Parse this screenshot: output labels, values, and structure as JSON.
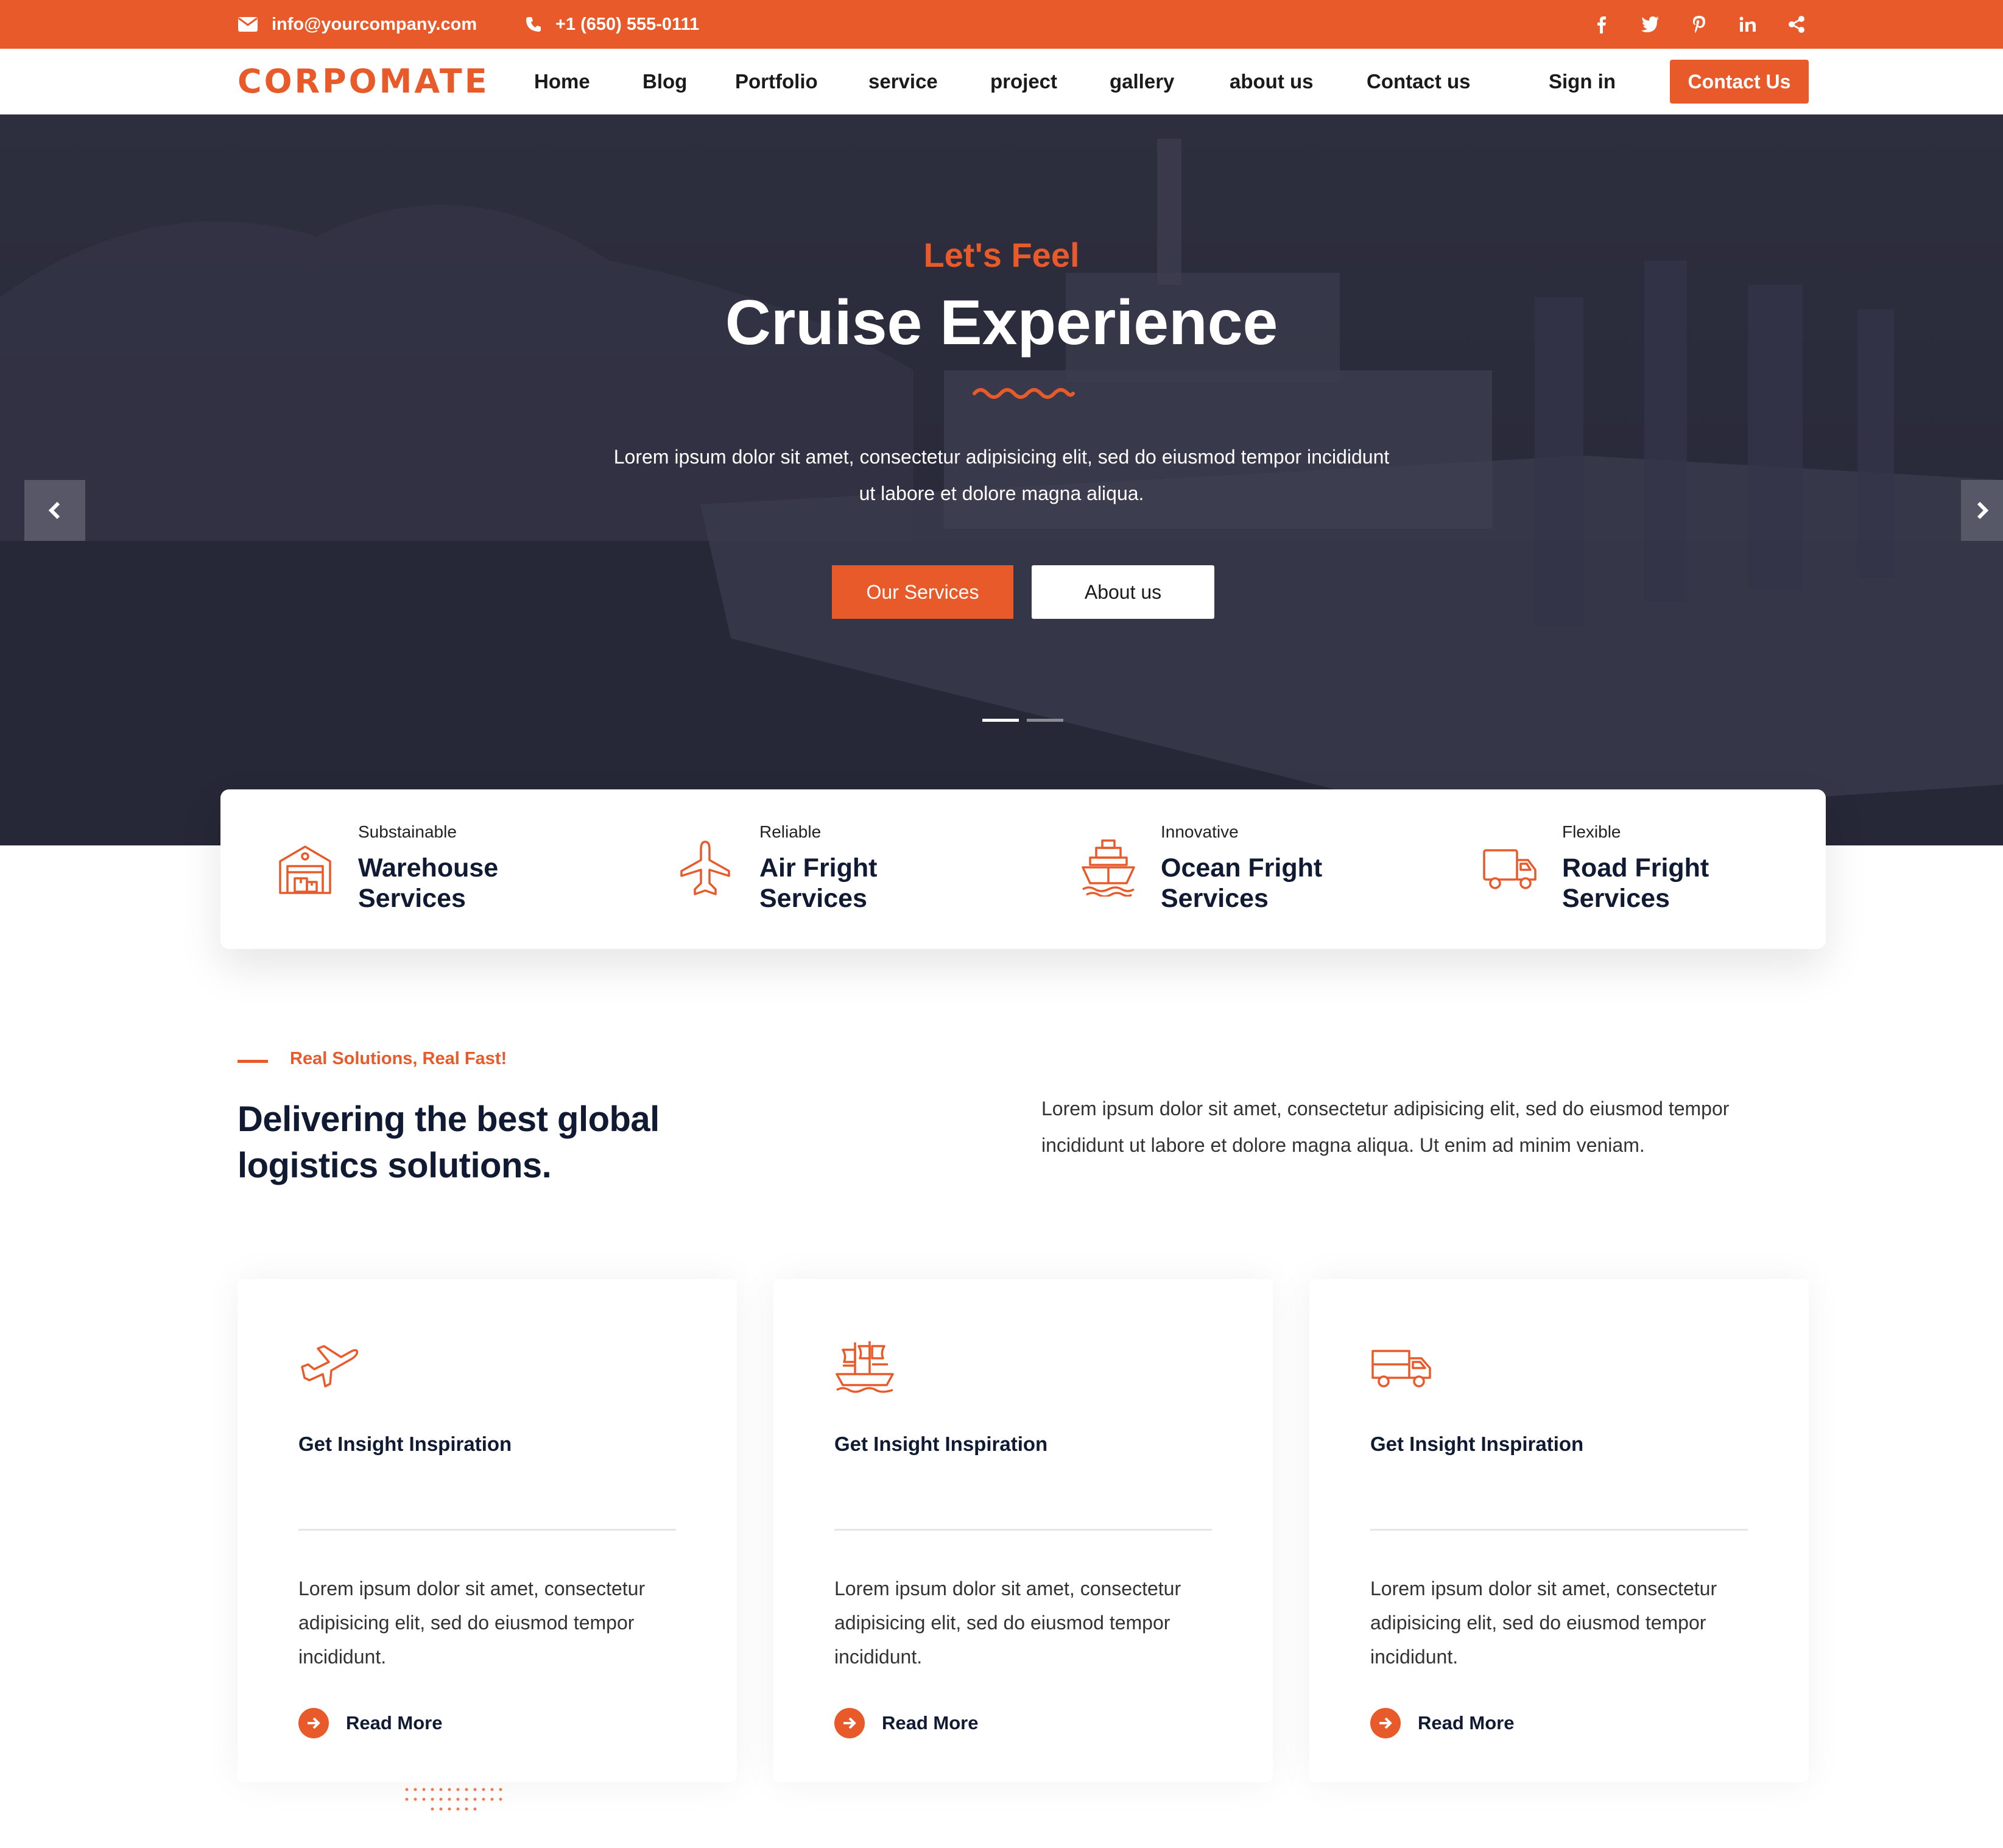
{
  "topbar": {
    "email": "info@yourcompany.com",
    "phone": "+1 (650) 555-0111",
    "socials": [
      "facebook-icon",
      "twitter-icon",
      "pinterest-icon",
      "linkedin-icon",
      "share-icon"
    ]
  },
  "navbar": {
    "logo": "CORPOMATE",
    "links": [
      "Home",
      "Blog",
      "Portfolio",
      "service",
      "project",
      "gallery",
      "about us",
      "Contact us"
    ],
    "signin": "Sign in",
    "cta": "Contact Us"
  },
  "hero": {
    "eyebrow": "Let's Feel",
    "title": "Cruise Experience",
    "description": "Lorem ipsum dolor sit amet, consectetur adipisicing elit, sed do eiusmod tempor incididunt ut labore et dolore magna aliqua.",
    "btn_primary": "Our Services",
    "btn_secondary": "About us",
    "slide_count": 2,
    "active_slide": 1
  },
  "features": [
    {
      "label": "Substainable",
      "title": "Warehouse Services",
      "icon": "warehouse-icon"
    },
    {
      "label": "Reliable",
      "title": "Air Fright Services",
      "icon": "airplane-icon"
    },
    {
      "label": "Innovative",
      "title": "Ocean Fright Services",
      "icon": "ship-icon"
    },
    {
      "label": "Flexible",
      "title": "Road Fright Services",
      "icon": "truck-icon"
    }
  ],
  "solutions": {
    "eyebrow": "Real Solutions, Real Fast!",
    "heading": "Delivering the best global logistics solutions.",
    "description": "Lorem ipsum dolor sit amet, consectetur adipisicing elit, sed do eiusmod tempor incididunt ut labore et dolore magna aliqua. Ut enim ad minim veniam."
  },
  "cards": [
    {
      "title": "Get Insight Inspiration",
      "text": "Lorem ipsum dolor sit amet, consectetur adipisicing elit, sed do eiusmod tempor incididunt.",
      "more": "Read More",
      "icon": "plane-icon"
    },
    {
      "title": "Get Insight Inspiration",
      "text": "Lorem ipsum dolor sit amet, consectetur adipisicing elit, sed do eiusmod tempor incididunt.",
      "more": "Read More",
      "icon": "sailing-ship-icon"
    },
    {
      "title": "Get Insight Inspiration",
      "text": "Lorem ipsum dolor sit amet, consectetur adipisicing elit, sed do eiusmod tempor incididunt.",
      "more": "Read More",
      "icon": "delivery-truck-icon"
    }
  ],
  "colors": {
    "accent": "#e85a2a",
    "dark": "#101a33",
    "hero_bg": "#292a3a"
  }
}
